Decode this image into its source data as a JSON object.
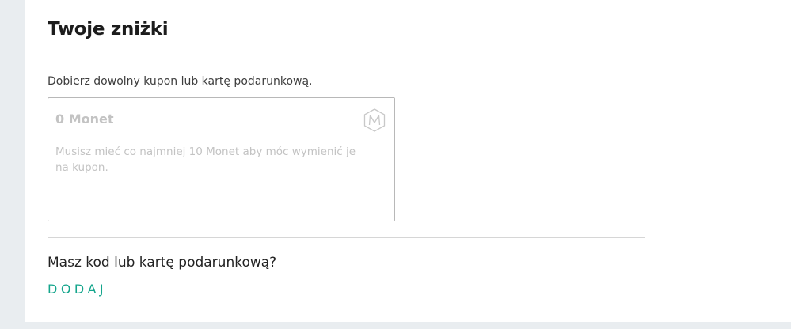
{
  "discounts": {
    "title": "Twoje zniżki",
    "intro": "Dobierz dowolny kupon lub kartę podarunkową.",
    "coupon": {
      "amount": "0 Monet",
      "description": "Musisz mieć co najmniej 10 Monet aby móc wymienić je na kupon.",
      "icon": "coin-icon"
    },
    "gift_code": {
      "question": "Masz kod lub kartę podarunkową?",
      "add_label": "DODAJ"
    }
  },
  "colors": {
    "accent": "#14a58c",
    "disabled_text": "#c3c3c3",
    "page_background": "#e9edf0"
  }
}
